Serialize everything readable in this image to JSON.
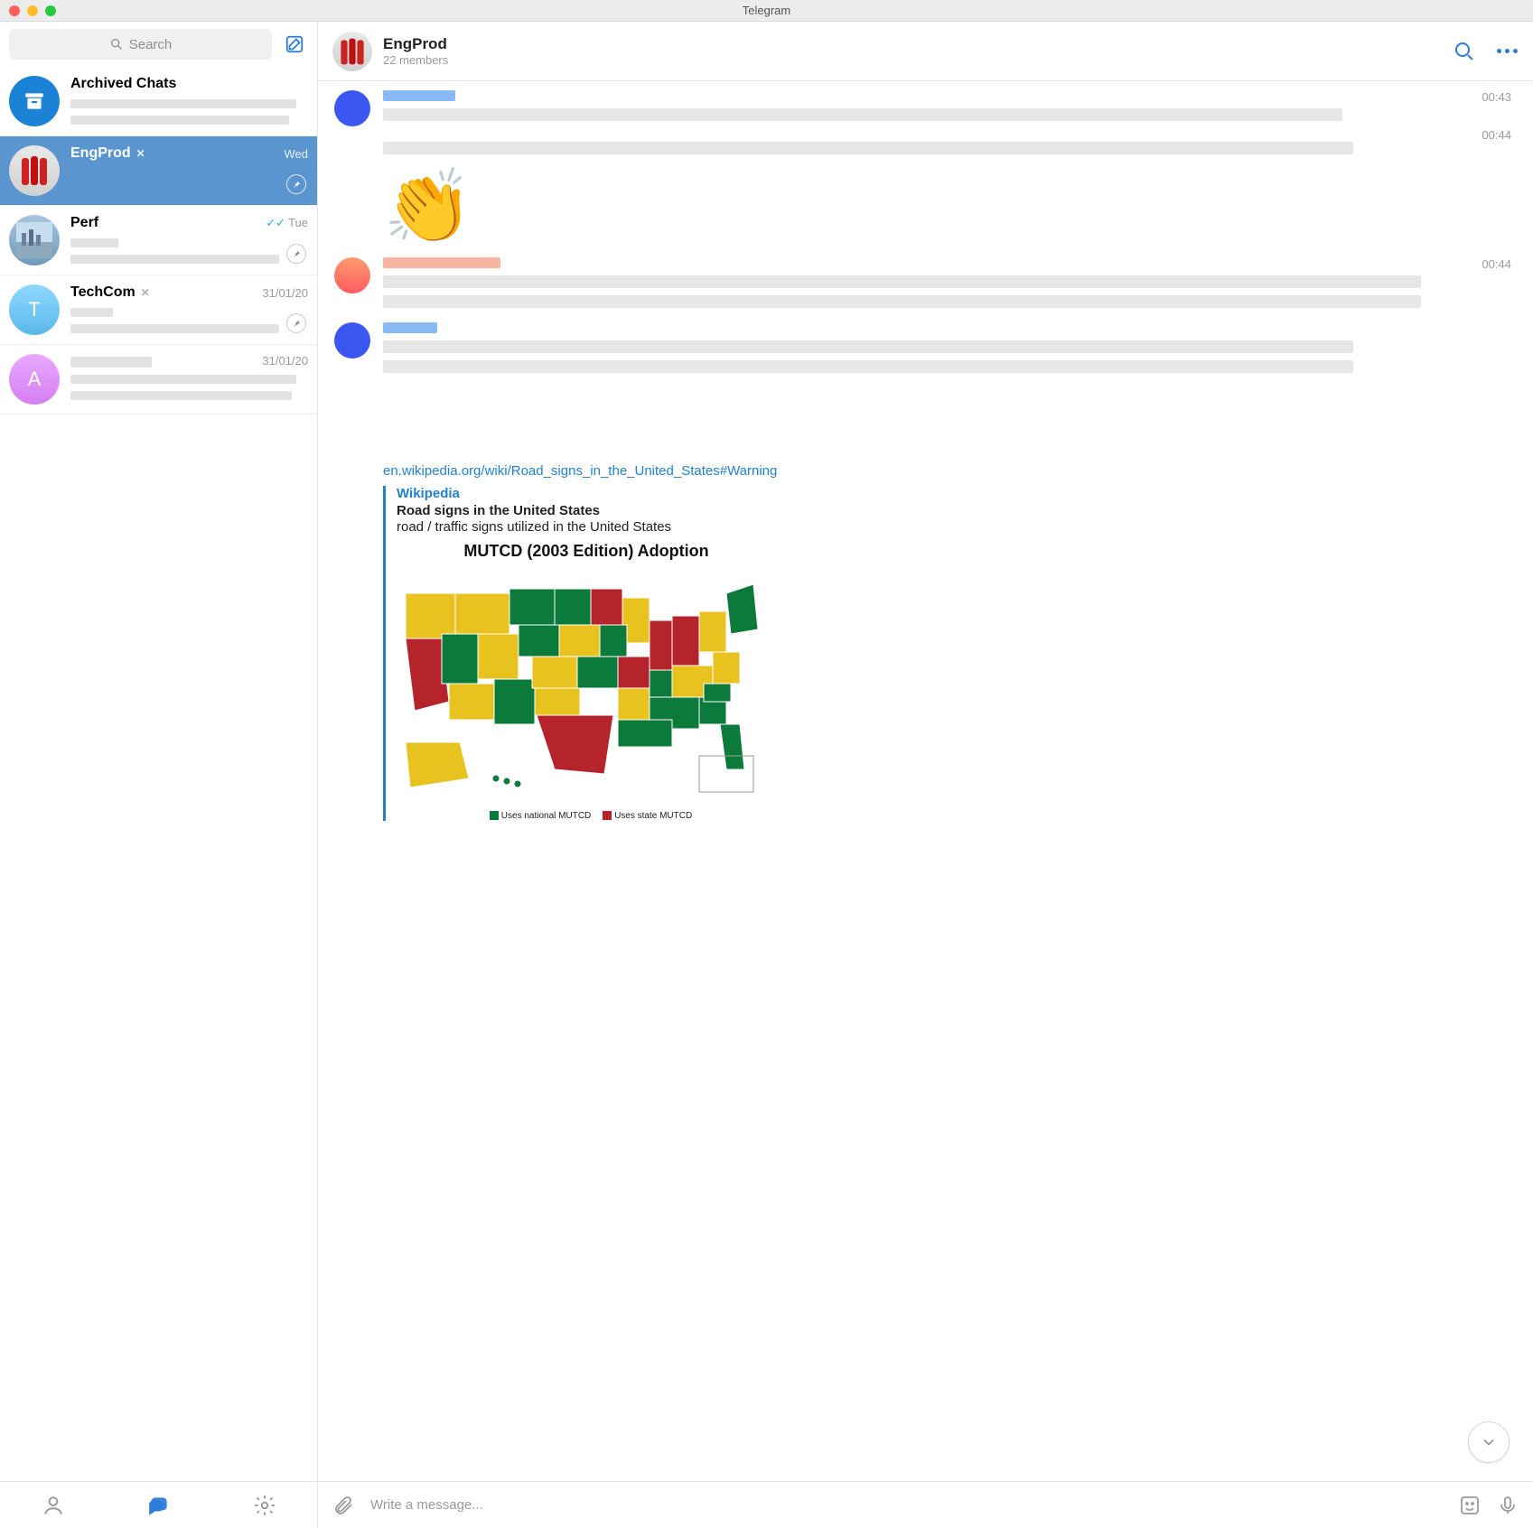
{
  "window": {
    "title": "Telegram"
  },
  "sidebar": {
    "search_placeholder": "Search",
    "archived_label": "Archived Chats",
    "chats": [
      {
        "name": "EngProd",
        "date": "Wed",
        "muted": true,
        "pinned": true,
        "selected": true,
        "avatar": "bottles"
      },
      {
        "name": "Perf",
        "date": "Tue",
        "checks": true,
        "pinned": true,
        "avatar": "city"
      },
      {
        "name": "TechCom",
        "date": "31/01/20",
        "muted": true,
        "pinned": true,
        "avatar": "t",
        "letter": "T"
      },
      {
        "name": "",
        "date": "31/01/20",
        "avatar": "a",
        "letter": "A"
      }
    ]
  },
  "header": {
    "title": "EngProd",
    "subtitle": "22 members"
  },
  "messages": {
    "times": [
      "00:43",
      "00:44",
      "00:44"
    ],
    "clap_emoji": "👏"
  },
  "link_preview": {
    "url": "en.wikipedia.org/wiki/Road_signs_in_the_United_States#Warning",
    "source": "Wikipedia",
    "title": "Road signs in the United States",
    "description": "road / traffic signs utilized in the United States",
    "image_title": "MUTCD (2003 Edition) Adoption",
    "legend_national": "Uses national MUTCD",
    "legend_state": "Uses state MUTCD"
  },
  "composer": {
    "placeholder": "Write a message..."
  }
}
